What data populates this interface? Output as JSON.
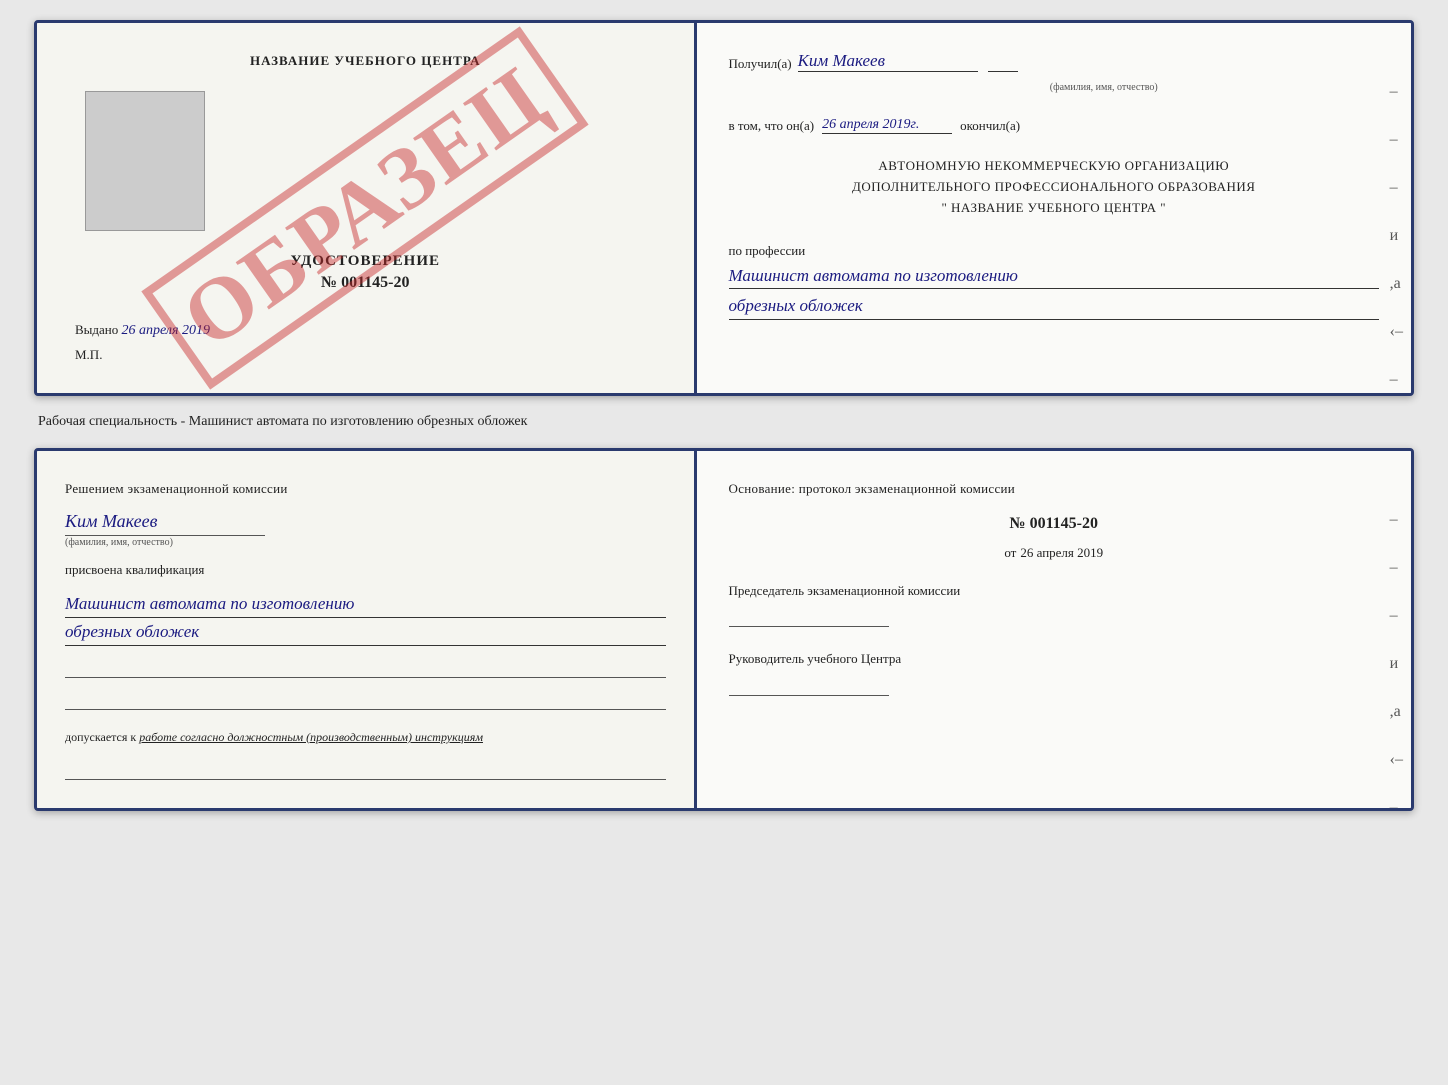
{
  "top_document": {
    "left": {
      "title": "НАЗВАНИЕ УЧЕБНОГО ЦЕНТРА",
      "watermark": "ОБРАЗЕЦ",
      "udostoverenie_label": "УДОСТОВЕРЕНИЕ",
      "number": "№ 001145-20",
      "vydano_label": "Выдано",
      "vydano_date": "26 апреля 2019",
      "mp_label": "М.П."
    },
    "right": {
      "poluchil_label": "Получил(а)",
      "recipient_name": "Ким Макеев",
      "fio_subtitle": "(фамилия, имя, отчество)",
      "vtom_label": "в том, что он(а)",
      "vtom_date": "26 апреля 2019г.",
      "okonchil_label": "окончил(а)",
      "org_line1": "АВТОНОМНУЮ НЕКОММЕРЧЕСКУЮ ОРГАНИЗАЦИЮ",
      "org_line2": "ДОПОЛНИТЕЛЬНОГО ПРОФЕССИОНАЛЬНОГО ОБРАЗОВАНИЯ",
      "org_line3": "\" НАЗВАНИЕ УЧЕБНОГО ЦЕНТРА \"",
      "po_professii_label": "по профессии",
      "profession_line1": "Машинист автомата по изготовлению",
      "profession_line2": "обрезных обложек"
    }
  },
  "separator_text": "Рабочая специальность - Машинист автомата по изготовлению обрезных обложек",
  "bottom_document": {
    "left": {
      "resheniem_text": "Решением экзаменационной комиссии",
      "recipient_name": "Ким Макеев",
      "fio_subtitle": "(фамилия, имя, отчество)",
      "prisvoena_label": "присвоена квалификация",
      "qualification_line1": "Машинист автомата по изготовлению",
      "qualification_line2": "обрезных обложек",
      "dopuskaetsya_label": "допускается к",
      "dopuskaetsya_italic": "работе согласно должностным (производственным) инструкциям"
    },
    "right": {
      "osnovanie_label": "Основание: протокол экзаменационной комиссии",
      "number": "№ 001145-20",
      "ot_label": "от",
      "ot_date": "26 апреля 2019",
      "predsedatel_label": "Председатель экзаменационной комиссии",
      "rukovoditel_label": "Руководитель учебного Центра"
    }
  }
}
